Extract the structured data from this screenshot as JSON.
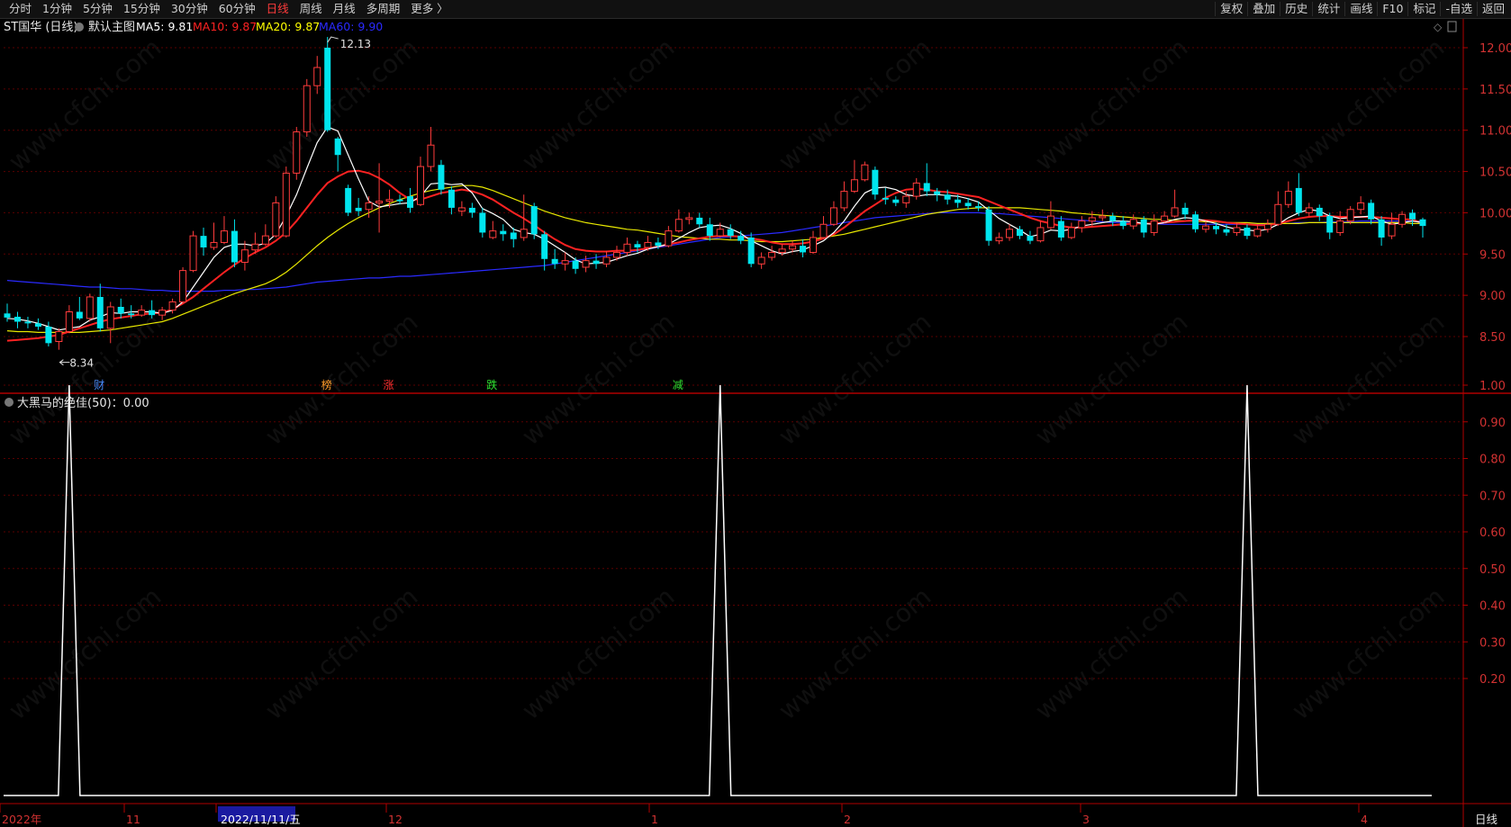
{
  "toolbar": {
    "tabs": [
      "分时",
      "1分钟",
      "5分钟",
      "15分钟",
      "30分钟",
      "60分钟",
      "日线",
      "周线",
      "月线",
      "多周期",
      "更多 〉"
    ],
    "active_tab": "日线",
    "right_buttons": [
      "复权",
      "叠加",
      "历史",
      "统计",
      "画线",
      "F10",
      "标记",
      "-自选",
      "返回"
    ]
  },
  "main_panel": {
    "stock_name": "ST国华",
    "period": "(日线)",
    "template": "默认主图",
    "ma_items": [
      {
        "label": "MA5: 9.81",
        "color": "#ffffff"
      },
      {
        "label": "MA10: 9.87",
        "color": "#ff2222"
      },
      {
        "label": "MA20: 9.87",
        "color": "#ffff00"
      },
      {
        "label": "MA60: 9.90",
        "color": "#2a2aff"
      }
    ],
    "high_marker": "12.13",
    "low_marker": "8.34",
    "events": [
      {
        "label": "财",
        "color": "#4a8cff"
      },
      {
        "label": "榜",
        "color": "#ff9d2a"
      },
      {
        "label": "涨",
        "color": "#ff3030"
      },
      {
        "label": "跌",
        "color": "#30e030"
      },
      {
        "label": "减",
        "color": "#30e030"
      }
    ]
  },
  "indicator_panel": {
    "title": "大黑马的绝佳(50)：0.00",
    "yticks": [
      "1.00",
      "0.90",
      "0.80",
      "0.70",
      "0.60",
      "0.50",
      "0.40",
      "0.30",
      "0.20"
    ]
  },
  "bottom_bar": {
    "ticks": [
      "2022年",
      "11",
      "2022/11/11/五",
      "12",
      "1",
      "2",
      "3",
      "4"
    ],
    "period_label": "日线"
  },
  "watermark": "www.cfchi.com",
  "chart_data": {
    "type": "candlestick",
    "ylim": [
      8.2,
      12.3
    ],
    "yticks": [
      "12.00",
      "11.50",
      "11.00",
      "10.50",
      "10.00",
      "9.50",
      "9.00",
      "8.50"
    ],
    "candles": [
      [
        8.78,
        8.73,
        8.9,
        8.68
      ],
      [
        8.74,
        8.68,
        8.8,
        8.6
      ],
      [
        8.68,
        8.66,
        8.74,
        8.6
      ],
      [
        8.66,
        8.62,
        8.72,
        8.58
      ],
      [
        8.62,
        8.42,
        8.68,
        8.38
      ],
      [
        8.44,
        8.56,
        8.6,
        8.34
      ],
      [
        8.56,
        8.8,
        8.88,
        8.54
      ],
      [
        8.8,
        8.72,
        8.98,
        8.7
      ],
      [
        8.72,
        8.98,
        9.02,
        8.68
      ],
      [
        8.98,
        8.6,
        9.14,
        8.56
      ],
      [
        8.6,
        8.86,
        8.92,
        8.42
      ],
      [
        8.86,
        8.78,
        8.96,
        8.72
      ],
      [
        8.78,
        8.76,
        8.88,
        8.72
      ],
      [
        8.76,
        8.82,
        8.88,
        8.74
      ],
      [
        8.82,
        8.76,
        8.94,
        8.72
      ],
      [
        8.76,
        8.82,
        8.86,
        8.7
      ],
      [
        8.82,
        8.92,
        8.96,
        8.78
      ],
      [
        8.92,
        9.3,
        9.34,
        8.9
      ],
      [
        9.3,
        9.72,
        9.78,
        9.28
      ],
      [
        9.72,
        9.58,
        9.82,
        9.48
      ],
      [
        9.58,
        9.64,
        9.88,
        9.55
      ],
      [
        9.64,
        9.78,
        9.96,
        9.62
      ],
      [
        9.78,
        9.4,
        9.92,
        9.34
      ],
      [
        9.4,
        9.55,
        9.66,
        9.3
      ],
      [
        9.55,
        9.62,
        9.76,
        9.5
      ],
      [
        9.62,
        9.72,
        9.86,
        9.6
      ],
      [
        9.72,
        10.12,
        10.2,
        9.7
      ],
      [
        9.72,
        10.48,
        10.56,
        9.7
      ],
      [
        10.48,
        10.98,
        11.04,
        10.4
      ],
      [
        10.98,
        11.54,
        11.62,
        10.92
      ],
      [
        11.54,
        11.76,
        11.9,
        11.44
      ],
      [
        12.0,
        11.0,
        12.13,
        10.98
      ],
      [
        10.9,
        10.7,
        10.92,
        10.5
      ],
      [
        10.3,
        10.0,
        10.34,
        9.96
      ],
      [
        10.06,
        10.02,
        10.18,
        9.96
      ],
      [
        10.04,
        10.12,
        10.2,
        9.94
      ],
      [
        10.12,
        10.14,
        10.6,
        9.76
      ],
      [
        10.14,
        10.16,
        10.28,
        10.06
      ],
      [
        10.16,
        10.14,
        10.22,
        10.1
      ],
      [
        10.2,
        10.06,
        10.3,
        10.0
      ],
      [
        10.1,
        10.56,
        10.68,
        10.08
      ],
      [
        10.56,
        10.82,
        11.04,
        10.5
      ],
      [
        10.58,
        10.28,
        10.64,
        10.22
      ],
      [
        10.28,
        10.06,
        10.32,
        9.98
      ],
      [
        10.02,
        10.06,
        10.14,
        9.96
      ],
      [
        10.06,
        10.0,
        10.12,
        9.94
      ],
      [
        10.0,
        9.76,
        10.06,
        9.7
      ],
      [
        9.7,
        9.78,
        9.9,
        9.68
      ],
      [
        9.78,
        9.74,
        9.86,
        9.66
      ],
      [
        9.76,
        9.68,
        9.82,
        9.58
      ],
      [
        9.7,
        9.8,
        10.22,
        9.66
      ],
      [
        10.08,
        9.74,
        10.12,
        9.68
      ],
      [
        9.74,
        9.44,
        9.78,
        9.3
      ],
      [
        9.44,
        9.38,
        9.56,
        9.32
      ],
      [
        9.38,
        9.42,
        9.52,
        9.3
      ],
      [
        9.42,
        9.32,
        9.46,
        9.26
      ],
      [
        9.34,
        9.42,
        9.48,
        9.28
      ],
      [
        9.42,
        9.38,
        9.5,
        9.32
      ],
      [
        9.38,
        9.46,
        9.54,
        9.34
      ],
      [
        9.46,
        9.52,
        9.6,
        9.42
      ],
      [
        9.52,
        9.62,
        9.7,
        9.48
      ],
      [
        9.62,
        9.58,
        9.66,
        9.52
      ],
      [
        9.58,
        9.64,
        9.72,
        9.54
      ],
      [
        9.64,
        9.6,
        9.7,
        9.56
      ],
      [
        9.6,
        9.78,
        9.84,
        9.58
      ],
      [
        9.78,
        9.92,
        10.04,
        9.76
      ],
      [
        9.92,
        9.94,
        10.0,
        9.86
      ],
      [
        9.94,
        9.86,
        10.0,
        9.82
      ],
      [
        9.86,
        9.72,
        9.94,
        9.66
      ],
      [
        9.72,
        9.8,
        9.88,
        9.7
      ],
      [
        9.8,
        9.72,
        9.86,
        9.68
      ],
      [
        9.72,
        9.66,
        9.78,
        9.62
      ],
      [
        9.7,
        9.38,
        9.76,
        9.34
      ],
      [
        9.38,
        9.46,
        9.52,
        9.32
      ],
      [
        9.46,
        9.52,
        9.6,
        9.42
      ],
      [
        9.52,
        9.56,
        9.62,
        9.48
      ],
      [
        9.56,
        9.6,
        9.66,
        9.52
      ],
      [
        9.6,
        9.52,
        9.68,
        9.46
      ],
      [
        9.52,
        9.7,
        9.78,
        9.5
      ],
      [
        9.7,
        9.86,
        9.96,
        9.68
      ],
      [
        9.86,
        10.06,
        10.14,
        9.84
      ],
      [
        10.06,
        10.26,
        10.38,
        10.02
      ],
      [
        10.26,
        10.4,
        10.64,
        10.24
      ],
      [
        10.4,
        10.58,
        10.62,
        10.38
      ],
      [
        10.52,
        10.22,
        10.56,
        10.16
      ],
      [
        10.18,
        10.16,
        10.3,
        10.1
      ],
      [
        10.16,
        10.12,
        10.2,
        10.08
      ],
      [
        10.12,
        10.2,
        10.26,
        10.06
      ],
      [
        10.2,
        10.36,
        10.42,
        10.16
      ],
      [
        10.36,
        10.26,
        10.6,
        10.2
      ],
      [
        10.26,
        10.22,
        10.3,
        10.14
      ],
      [
        10.22,
        10.16,
        10.28,
        10.1
      ],
      [
        10.16,
        10.12,
        10.22,
        10.06
      ],
      [
        10.12,
        10.08,
        10.18,
        10.04
      ],
      [
        10.08,
        10.06,
        10.14,
        10.02
      ],
      [
        10.04,
        9.66,
        10.08,
        9.6
      ],
      [
        9.66,
        9.7,
        9.76,
        9.62
      ],
      [
        9.7,
        9.8,
        9.86,
        9.66
      ],
      [
        9.8,
        9.72,
        9.84,
        9.68
      ],
      [
        9.72,
        9.66,
        9.78,
        9.62
      ],
      [
        9.66,
        9.82,
        9.9,
        9.64
      ],
      [
        9.82,
        9.96,
        10.14,
        9.8
      ],
      [
        9.9,
        9.7,
        9.96,
        9.66
      ],
      [
        9.7,
        9.82,
        9.88,
        9.68
      ],
      [
        9.82,
        9.9,
        9.96,
        9.76
      ],
      [
        9.9,
        9.94,
        10.02,
        9.84
      ],
      [
        9.94,
        9.96,
        10.04,
        9.9
      ],
      [
        9.96,
        9.9,
        10.0,
        9.84
      ],
      [
        9.9,
        9.84,
        9.96,
        9.8
      ],
      [
        9.84,
        9.92,
        9.98,
        9.8
      ],
      [
        9.92,
        9.76,
        9.96,
        9.7
      ],
      [
        9.76,
        9.9,
        9.98,
        9.72
      ],
      [
        9.9,
        9.96,
        10.02,
        9.88
      ],
      [
        9.96,
        10.06,
        10.28,
        9.94
      ],
      [
        10.06,
        9.98,
        10.12,
        9.92
      ],
      [
        9.98,
        9.8,
        10.02,
        9.76
      ],
      [
        9.8,
        9.84,
        9.9,
        9.76
      ],
      [
        9.84,
        9.8,
        9.88,
        9.74
      ],
      [
        9.8,
        9.76,
        9.86,
        9.72
      ],
      [
        9.76,
        9.82,
        9.88,
        9.72
      ],
      [
        9.82,
        9.72,
        9.86,
        9.68
      ],
      [
        9.72,
        9.8,
        9.86,
        9.7
      ],
      [
        9.8,
        9.86,
        9.92,
        9.76
      ],
      [
        9.86,
        10.1,
        10.26,
        9.84
      ],
      [
        10.1,
        10.26,
        10.38,
        10.06
      ],
      [
        10.3,
        10.0,
        10.48,
        9.96
      ],
      [
        10.0,
        10.06,
        10.12,
        9.96
      ],
      [
        10.06,
        9.96,
        10.1,
        9.9
      ],
      [
        9.96,
        9.76,
        10.0,
        9.68
      ],
      [
        9.76,
        9.9,
        10.02,
        9.72
      ],
      [
        9.9,
        10.04,
        10.08,
        9.86
      ],
      [
        10.04,
        10.12,
        10.2,
        9.98
      ],
      [
        10.12,
        9.92,
        10.16,
        9.86
      ],
      [
        9.92,
        9.7,
        9.96,
        9.6
      ],
      [
        9.72,
        9.86,
        10.0,
        9.68
      ],
      [
        9.86,
        9.98,
        10.02,
        9.82
      ],
      [
        10.0,
        9.92,
        10.04,
        9.84
      ],
      [
        9.92,
        9.84,
        9.94,
        9.7
      ]
    ],
    "ma5": [
      8.72,
      8.71,
      8.69,
      8.66,
      8.62,
      8.58,
      8.6,
      8.62,
      8.7,
      8.74,
      8.79,
      8.78,
      8.8,
      8.8,
      8.8,
      8.78,
      8.82,
      8.92,
      9.1,
      9.28,
      9.46,
      9.58,
      9.62,
      9.62,
      9.6,
      9.63,
      9.74,
      9.96,
      10.22,
      10.54,
      10.85,
      11.04,
      10.99,
      10.7,
      10.41,
      10.14,
      10.07,
      10.09,
      10.11,
      10.12,
      10.2,
      10.35,
      10.36,
      10.34,
      10.35,
      10.24,
      10.05,
      9.99,
      9.92,
      9.8,
      9.76,
      9.74,
      9.68,
      9.6,
      9.52,
      9.43,
      9.38,
      9.39,
      9.4,
      9.44,
      9.48,
      9.51,
      9.56,
      9.59,
      9.62,
      9.69,
      9.76,
      9.82,
      9.84,
      9.85,
      9.81,
      9.75,
      9.66,
      9.6,
      9.54,
      9.5,
      9.53,
      9.55,
      9.6,
      9.66,
      9.76,
      9.9,
      10.08,
      10.24,
      10.3,
      10.31,
      10.28,
      10.22,
      10.2,
      10.22,
      10.22,
      10.21,
      10.2,
      10.17,
      10.13,
      10.03,
      9.93,
      9.86,
      9.79,
      9.71,
      9.74,
      9.79,
      9.78,
      9.8,
      9.84,
      9.86,
      9.88,
      9.9,
      9.9,
      9.89,
      9.87,
      9.86,
      9.88,
      9.92,
      9.94,
      9.93,
      9.9,
      9.87,
      9.83,
      9.8,
      9.79,
      9.78,
      9.8,
      9.86,
      9.94,
      10.0,
      10.04,
      10.02,
      9.96,
      9.93,
      9.94,
      9.95,
      9.96,
      9.9,
      9.86,
      9.88,
      9.9,
      9.88
    ],
    "ma10": [
      8.45,
      8.46,
      8.47,
      8.48,
      8.5,
      8.52,
      8.56,
      8.6,
      8.64,
      8.68,
      8.71,
      8.73,
      8.75,
      8.77,
      8.78,
      8.79,
      8.83,
      8.9,
      8.98,
      9.08,
      9.18,
      9.28,
      9.37,
      9.45,
      9.52,
      9.58,
      9.66,
      9.76,
      9.9,
      10.06,
      10.22,
      10.36,
      10.44,
      10.5,
      10.51,
      10.48,
      10.42,
      10.34,
      10.24,
      10.16,
      10.16,
      10.2,
      10.24,
      10.26,
      10.28,
      10.26,
      10.22,
      10.16,
      10.08,
      10.0,
      9.93,
      9.85,
      9.76,
      9.68,
      9.61,
      9.56,
      9.54,
      9.53,
      9.53,
      9.54,
      9.54,
      9.55,
      9.57,
      9.59,
      9.62,
      9.64,
      9.67,
      9.69,
      9.71,
      9.72,
      9.72,
      9.71,
      9.69,
      9.67,
      9.64,
      9.62,
      9.62,
      9.63,
      9.65,
      9.69,
      9.74,
      9.82,
      9.92,
      10.02,
      10.1,
      10.18,
      10.24,
      10.28,
      10.29,
      10.28,
      10.26,
      10.25,
      10.23,
      10.21,
      10.19,
      10.14,
      10.09,
      10.04,
      9.99,
      9.94,
      9.9,
      9.87,
      9.84,
      9.82,
      9.82,
      9.83,
      9.84,
      9.85,
      9.86,
      9.87,
      9.87,
      9.87,
      9.88,
      9.89,
      9.9,
      9.91,
      9.91,
      9.9,
      9.88,
      9.87,
      9.86,
      9.85,
      9.85,
      9.87,
      9.9,
      9.93,
      9.95,
      9.96,
      9.96,
      9.95,
      9.95,
      9.95,
      9.95,
      9.94,
      9.93,
      9.92,
      9.92,
      9.87
    ],
    "ma20": [
      8.57,
      8.56,
      8.56,
      8.55,
      8.55,
      8.55,
      8.55,
      8.55,
      8.56,
      8.57,
      8.58,
      8.6,
      8.62,
      8.64,
      8.66,
      8.68,
      8.72,
      8.77,
      8.82,
      8.87,
      8.92,
      8.97,
      9.02,
      9.06,
      9.1,
      9.14,
      9.2,
      9.28,
      9.38,
      9.49,
      9.6,
      9.7,
      9.79,
      9.87,
      9.94,
      10.0,
      10.06,
      10.11,
      10.16,
      10.2,
      10.24,
      10.27,
      10.29,
      10.31,
      10.33,
      10.33,
      10.31,
      10.27,
      10.22,
      10.17,
      10.12,
      10.07,
      10.02,
      9.98,
      9.94,
      9.91,
      9.88,
      9.86,
      9.84,
      9.82,
      9.8,
      9.79,
      9.77,
      9.75,
      9.73,
      9.71,
      9.7,
      9.69,
      9.68,
      9.68,
      9.67,
      9.67,
      9.66,
      9.65,
      9.65,
      9.65,
      9.66,
      9.67,
      9.68,
      9.7,
      9.72,
      9.74,
      9.77,
      9.8,
      9.83,
      9.86,
      9.89,
      9.92,
      9.95,
      9.98,
      10.0,
      10.02,
      10.04,
      10.05,
      10.06,
      10.06,
      10.06,
      10.06,
      10.06,
      10.05,
      10.04,
      10.03,
      10.02,
      10.0,
      9.99,
      9.98,
      9.97,
      9.96,
      9.95,
      9.94,
      9.93,
      9.92,
      9.92,
      9.91,
      9.9,
      9.9,
      9.89,
      9.89,
      9.88,
      9.88,
      9.88,
      9.87,
      9.87,
      9.87,
      9.87,
      9.87,
      9.88,
      9.88,
      9.88,
      9.88,
      9.88,
      9.88,
      9.88,
      9.88,
      9.88,
      9.88,
      9.87,
      9.87
    ],
    "ma60": [
      9.18,
      9.17,
      9.16,
      9.15,
      9.14,
      9.13,
      9.12,
      9.11,
      9.1,
      9.1,
      9.09,
      9.08,
      9.08,
      9.07,
      9.06,
      9.06,
      9.05,
      9.05,
      9.05,
      9.05,
      9.05,
      9.06,
      9.06,
      9.07,
      9.07,
      9.08,
      9.09,
      9.1,
      9.12,
      9.14,
      9.16,
      9.17,
      9.18,
      9.19,
      9.2,
      9.21,
      9.21,
      9.22,
      9.23,
      9.23,
      9.24,
      9.25,
      9.26,
      9.27,
      9.28,
      9.29,
      9.3,
      9.31,
      9.32,
      9.33,
      9.34,
      9.35,
      9.36,
      9.38,
      9.4,
      9.42,
      9.44,
      9.46,
      9.48,
      9.5,
      9.52,
      9.54,
      9.56,
      9.58,
      9.6,
      9.62,
      9.64,
      9.66,
      9.68,
      9.7,
      9.71,
      9.72,
      9.73,
      9.74,
      9.75,
      9.76,
      9.78,
      9.8,
      9.82,
      9.84,
      9.86,
      9.88,
      9.9,
      9.92,
      9.94,
      9.95,
      9.96,
      9.97,
      9.98,
      9.99,
      10.0,
      10.0,
      10.0,
      10.0,
      10.0,
      9.99,
      9.99,
      9.98,
      9.97,
      9.96,
      9.95,
      9.94,
      9.93,
      9.92,
      9.91,
      9.9,
      9.89,
      9.88,
      9.88,
      9.87,
      9.87,
      9.87,
      9.86,
      9.86,
      9.86,
      9.86,
      9.86,
      9.86,
      9.86,
      9.86,
      9.86,
      9.86,
      9.87,
      9.87,
      9.87,
      9.88,
      9.88,
      9.88,
      9.89,
      9.89,
      9.89,
      9.9,
      9.9,
      9.9,
      9.9,
      9.9,
      9.9,
      9.9
    ],
    "indicator": {
      "ylim": [
        0,
        1.05
      ],
      "values_description": "0 everywhere except three spikes to 1.00",
      "spike_indices": [
        6,
        69,
        120
      ],
      "spike_value": 1.0
    }
  }
}
